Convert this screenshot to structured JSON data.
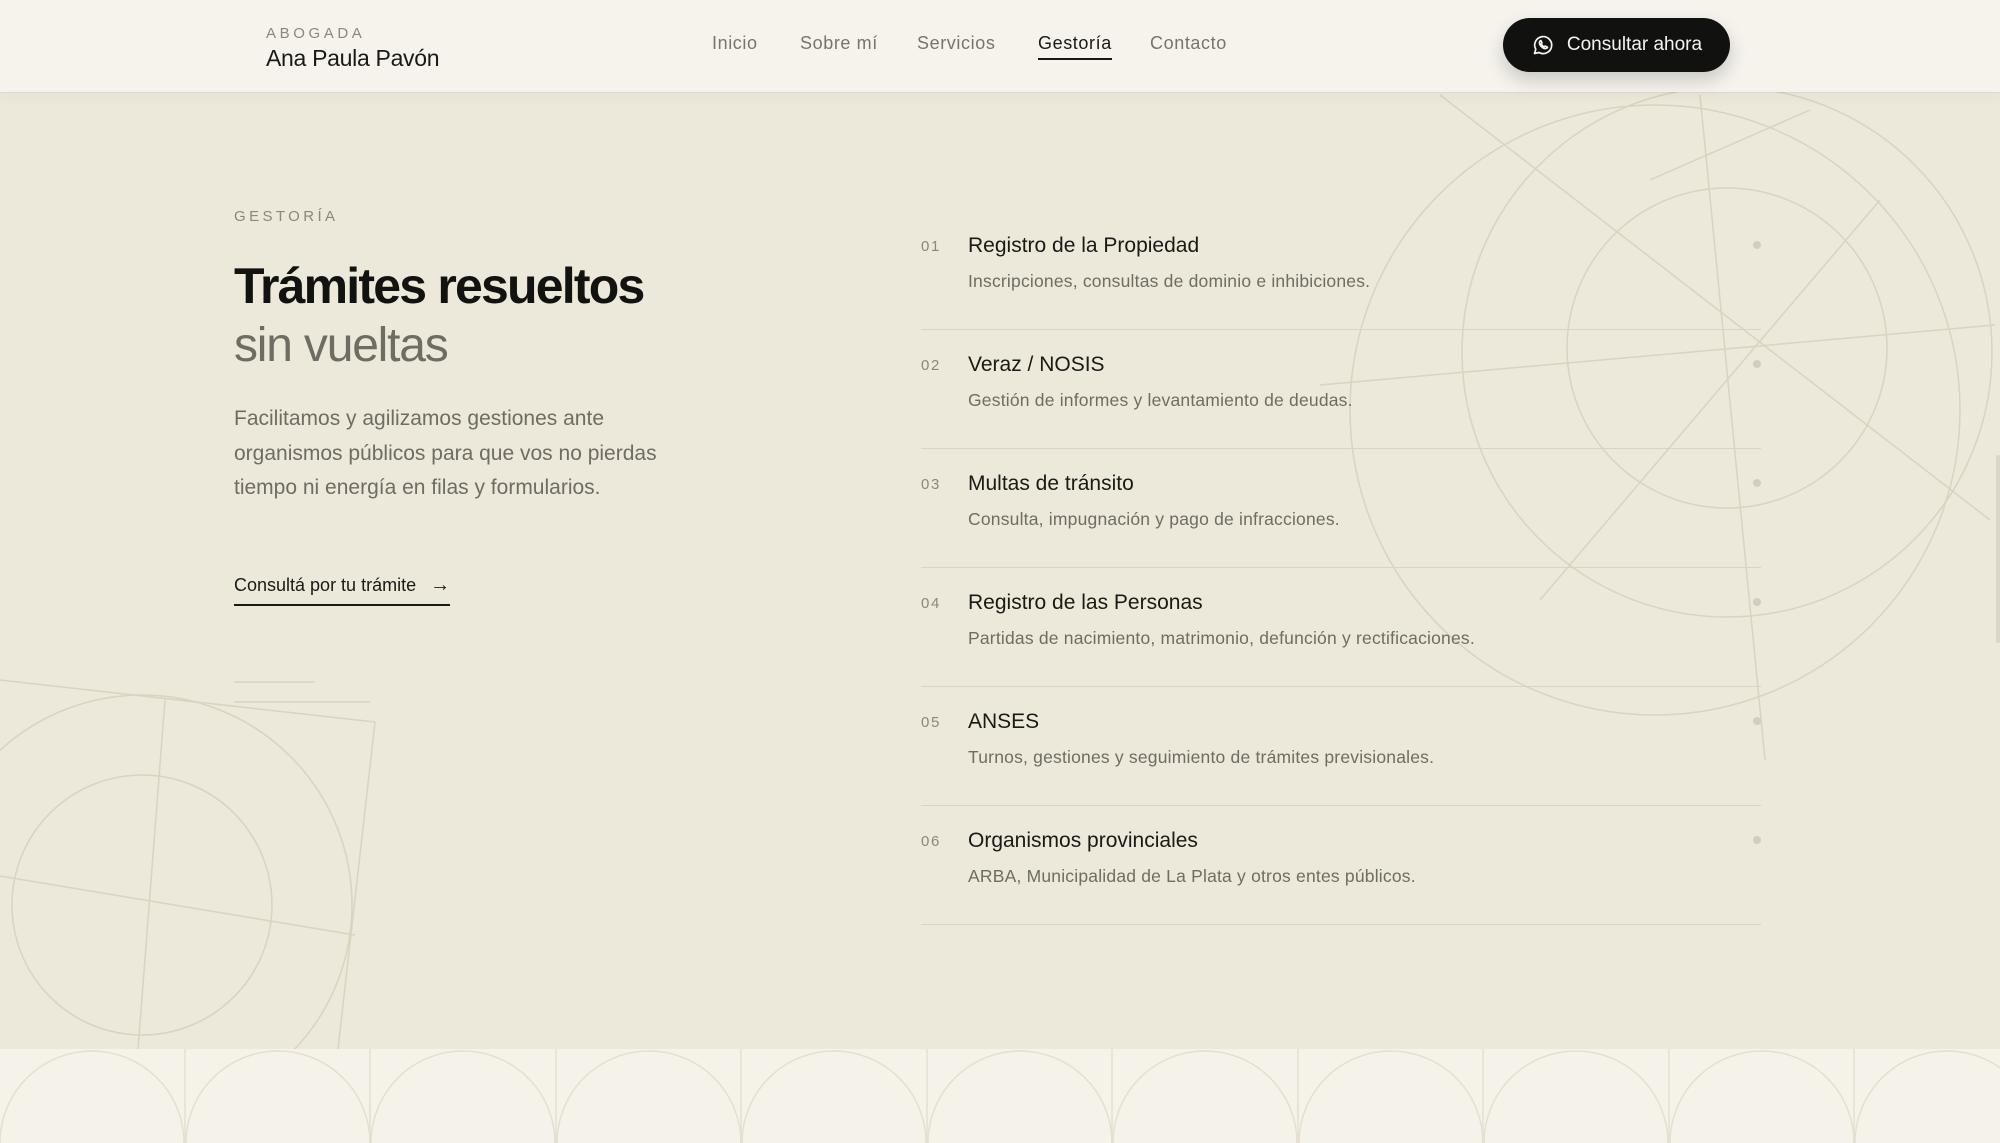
{
  "header": {
    "brand_eyebrow": "ABOGADA",
    "brand_name": "Ana Paula Pavón",
    "nav": [
      {
        "label": "Inicio",
        "active": false
      },
      {
        "label": "Sobre mí",
        "active": false
      },
      {
        "label": "Servicios",
        "active": false
      },
      {
        "label": "Gestoría",
        "active": true
      },
      {
        "label": "Contacto",
        "active": false
      }
    ],
    "cta_label": "Consultar ahora",
    "cta_icon": "whatsapp-icon"
  },
  "intro": {
    "eyebrow": "GESTORÍA",
    "title": "Trámites resueltos",
    "subtitle": "sin vueltas",
    "description": "Facilitamos y agilizamos gestiones ante organismos públicos para que vos no pierdas tiempo ni energía en filas y formularios.",
    "link_label": "Consultá por tu trámite",
    "link_icon": "arrow-right-icon"
  },
  "services": [
    {
      "number": "01",
      "title": "Registro de la Propiedad",
      "description": "Inscripciones, consultas de dominio e inhibiciones."
    },
    {
      "number": "02",
      "title": "Veraz / NOSIS",
      "description": "Gestión de informes y levantamiento de deudas."
    },
    {
      "number": "03",
      "title": "Multas de tránsito",
      "description": "Consulta, impugnación y pago de infracciones."
    },
    {
      "number": "04",
      "title": "Registro de las Personas",
      "description": "Partidas de nacimiento, matrimonio, defunción y rectificaciones."
    },
    {
      "number": "05",
      "title": "ANSES",
      "description": "Turnos, gestiones y seguimiento de trámites previsionales."
    },
    {
      "number": "06",
      "title": "Organismos provinciales",
      "description": "ARBA, Municipalidad de La Plata y otros entes públicos."
    }
  ],
  "colors": {
    "page_bg": "#ece8da",
    "header_bg": "#f5f3ec",
    "accent_dark": "#111110",
    "muted_text": "#6f6c63",
    "divider": "#d8d3c3"
  }
}
